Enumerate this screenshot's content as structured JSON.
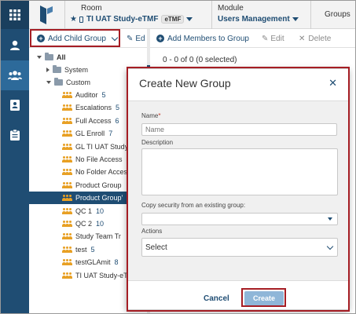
{
  "header": {
    "room_label": "Room",
    "room_name": "TI UAT Study-eTMF",
    "room_badge": "eTMF",
    "module_label": "Module",
    "module_name": "Users Management",
    "groups_label": "Groups"
  },
  "toolbar": {
    "add_child_group": "Add Child Group",
    "edit_partial": "Ed",
    "add_members": "Add Members to Group",
    "edit": "Edit",
    "delete": "Delete"
  },
  "content": {
    "status": "0 - 0 of 0 (0 selected)"
  },
  "tree": {
    "root": "All",
    "system": "System",
    "custom": "Custom",
    "items": [
      {
        "label": "Auditor",
        "count": "5"
      },
      {
        "label": "Escalations",
        "count": "5"
      },
      {
        "label": "Full Access",
        "count": "6"
      },
      {
        "label": "GL Enroll",
        "count": "7"
      },
      {
        "label": "GL TI UAT Study",
        "count": ""
      },
      {
        "label": "No File Access",
        "count": "5"
      },
      {
        "label": "No Folder Acces",
        "count": ""
      },
      {
        "label": "Product Group",
        "count": ""
      },
      {
        "label": "Product Group'",
        "count": ""
      },
      {
        "label": "QC 1",
        "count": "10"
      },
      {
        "label": "QC 2",
        "count": "10"
      },
      {
        "label": "Study Team Tr",
        "count": ""
      },
      {
        "label": "test",
        "count": "5"
      },
      {
        "label": "testGLAmit",
        "count": "8"
      },
      {
        "label": "TI UAT Study-eT",
        "count": ""
      }
    ]
  },
  "modal": {
    "title": "Create New Group",
    "name_label": "Name",
    "name_required": "*",
    "name_placeholder": "Name",
    "description_label": "Description",
    "copy_security_label": "Copy security from an existing group:",
    "actions_label": "Actions",
    "actions_value": "Select",
    "cancel": "Cancel",
    "create": "Create"
  },
  "colors": {
    "primary": "#1f4d73",
    "highlight_border": "#a51d24",
    "group_icon": "#e8a024",
    "create_button": "#8fb6d8"
  },
  "icons": [
    "apps-grid-icon",
    "user-icon",
    "users-icon",
    "contact-card-icon",
    "clipboard-icon",
    "star-icon",
    "phone-icon",
    "plus-circle-icon",
    "pencil-icon",
    "close-icon",
    "folder-icon",
    "group-icon"
  ]
}
